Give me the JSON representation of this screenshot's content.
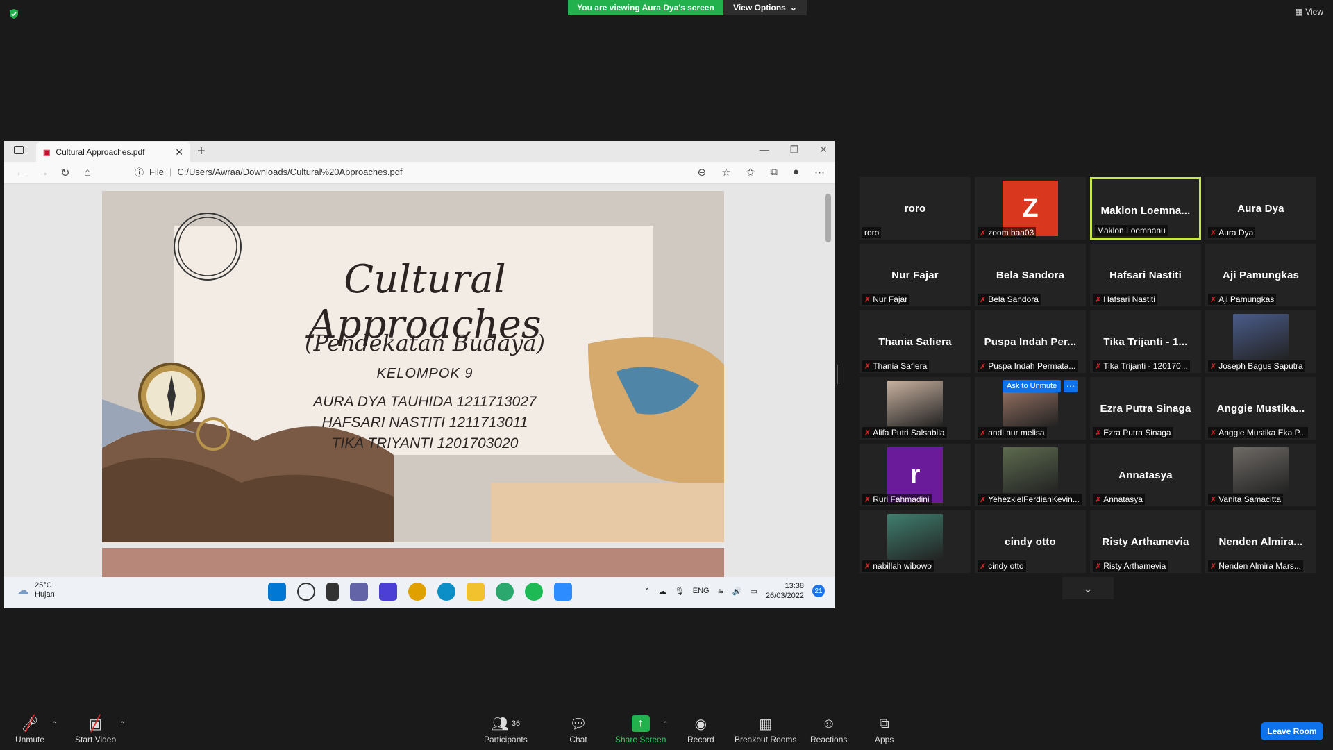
{
  "meeting": {
    "viewing_banner": "You are viewing Aura Dya's screen",
    "view_options": "View Options",
    "view_button": "View"
  },
  "browser": {
    "tab_title": "Cultural Approaches.pdf",
    "url_prefix": "File",
    "url": "C:/Users/Awraa/Downloads/Cultural%20Approaches.pdf"
  },
  "slide": {
    "title": "Cultural Approaches",
    "subtitle": "(Pendekatan Budaya)",
    "group": "KELOMPOK 9",
    "members": [
      "AURA DYA TAUHIDA 1211713027",
      "HAFSARI NASTITI 1211713011",
      "TIKA TRIYANTI 1201703020"
    ]
  },
  "windows_taskbar": {
    "temperature": "25°C",
    "weather": "Hujan",
    "language": "ENG",
    "time": "13:38",
    "date": "26/03/2022",
    "notifications": "21"
  },
  "participants": [
    {
      "big": "roro",
      "label": "roro",
      "muted": false
    },
    {
      "big": "Z",
      "label": "zoom baa03",
      "muted": true,
      "avatar_color": "#d9381e"
    },
    {
      "big": "Maklon  Loemna...",
      "label": "Maklon Loemnanu",
      "muted": false,
      "active": true
    },
    {
      "big": "Aura Dya",
      "label": "Aura Dya",
      "muted": true
    },
    {
      "big": "Nur Fajar",
      "label": "Nur Fajar",
      "muted": true
    },
    {
      "big": "Bela Sandora",
      "label": "Bela Sandora",
      "muted": true
    },
    {
      "big": "Hafsari Nastiti",
      "label": "Hafsari Nastiti",
      "muted": true
    },
    {
      "big": "Aji Pamungkas",
      "label": "Aji Pamungkas",
      "muted": true
    },
    {
      "big": "Thania Safiera",
      "label": "Thania Safiera",
      "muted": true
    },
    {
      "big": "Puspa  Indah  Per...",
      "label": "Puspa Indah Permata...",
      "muted": true
    },
    {
      "big": "Tika Trijanti  - 1...",
      "label": "Tika Trijanti  - 120170...",
      "muted": true
    },
    {
      "big": "",
      "label": "Joseph Bagus Saputra",
      "muted": true,
      "photo": "#4a5c8a"
    },
    {
      "big": "",
      "label": "Alifa Putri Salsabila",
      "muted": true,
      "photo": "#c9b2a0"
    },
    {
      "big": "",
      "label": "andi nur melisa",
      "muted": true,
      "photo": "#a57c6b",
      "ask_unmute": "Ask to Unmute"
    },
    {
      "big": "Ezra Putra Sinaga",
      "label": "Ezra Putra Sinaga",
      "muted": true
    },
    {
      "big": "Anggie  Mustika...",
      "label": "Anggie Mustika Eka P...",
      "muted": true
    },
    {
      "big": "r",
      "label": "Ruri Fahmadini",
      "muted": true,
      "avatar_color": "#6a1b9a"
    },
    {
      "big": "",
      "label": "YehezkielFerdianKevin...",
      "muted": true,
      "photo": "#5d6b4f"
    },
    {
      "big": "Annatasya",
      "label": "Annatasya",
      "muted": true
    },
    {
      "big": "",
      "label": "Vanita Samacitta",
      "muted": true,
      "photo": "#6e6a66"
    },
    {
      "big": "",
      "label": "nabillah wibowo",
      "muted": true,
      "photo": "#3f7f6e"
    },
    {
      "big": "cindy otto",
      "label": "cindy otto",
      "muted": true
    },
    {
      "big": "Risty Arthamevia",
      "label": "Risty Arthamevia",
      "muted": true
    },
    {
      "big": "Nenden  Almira...",
      "label": "Nenden Almira Mars...",
      "muted": true
    }
  ],
  "toolbar": {
    "unmute": "Unmute",
    "start_video": "Start Video",
    "participants": "Participants",
    "participants_count": "36",
    "chat": "Chat",
    "share_screen": "Share Screen",
    "record": "Record",
    "breakout": "Breakout Rooms",
    "reactions": "Reactions",
    "apps": "Apps",
    "leave": "Leave Room"
  }
}
